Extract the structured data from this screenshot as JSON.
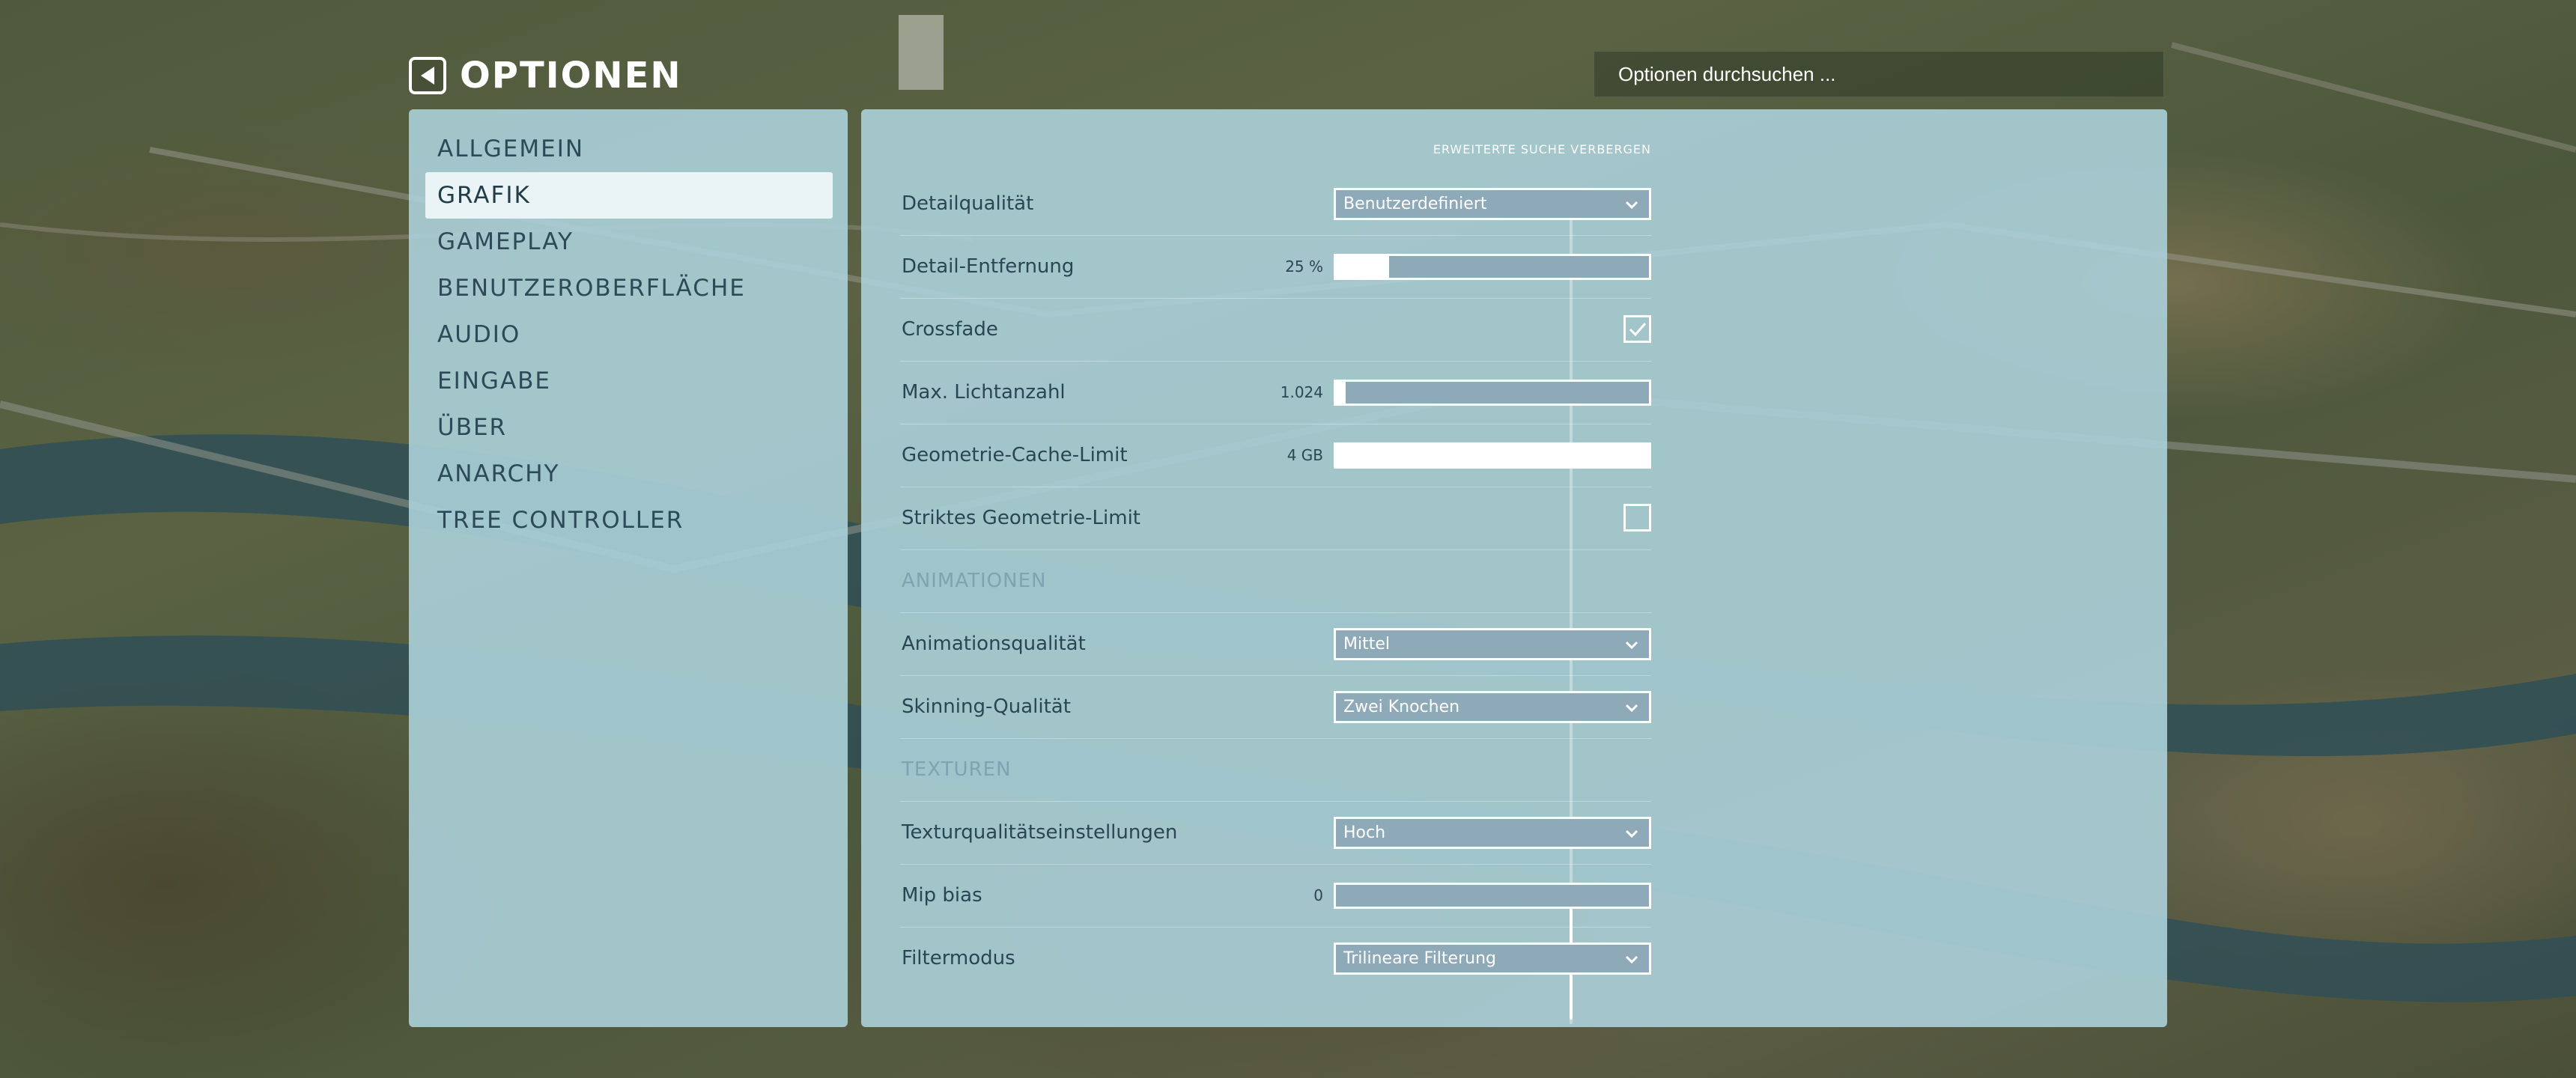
{
  "header": {
    "title": "OPTIONEN",
    "search_placeholder": "Optionen durchsuchen ..."
  },
  "sidebar": {
    "items": [
      {
        "label": "ALLGEMEIN",
        "active": false
      },
      {
        "label": "GRAFIK",
        "active": true
      },
      {
        "label": "GAMEPLAY",
        "active": false
      },
      {
        "label": "BENUTZEROBERFLÄCHE",
        "active": false
      },
      {
        "label": "AUDIO",
        "active": false
      },
      {
        "label": "EINGABE",
        "active": false
      },
      {
        "label": "ÜBER",
        "active": false
      },
      {
        "label": "ANARCHY",
        "active": false
      },
      {
        "label": "TREE CONTROLLER",
        "active": false
      }
    ]
  },
  "main": {
    "advanced_search_toggle": "ERWEITERTE SUCHE VERBERGEN",
    "settings": {
      "detail_quality": {
        "label": "Detailqualität",
        "value": "Benutzerdefiniert"
      },
      "detail_distance": {
        "label": "Detail-Entfernung",
        "value": "25 %",
        "fill_fraction": 0.17
      },
      "crossfade": {
        "label": "Crossfade",
        "checked": true
      },
      "max_lights": {
        "label": "Max. Lichtanzahl",
        "value": "1.024",
        "fill_fraction": 0.03
      },
      "geometry_cache": {
        "label": "Geometrie-Cache-Limit",
        "value": "4 GB",
        "fill_fraction": 1.0
      },
      "strict_geometry": {
        "label": "Striktes Geometrie-Limit",
        "checked": false
      },
      "animations_section": "ANIMATIONEN",
      "animation_quality": {
        "label": "Animationsqualität",
        "value": "Mittel"
      },
      "skinning_quality": {
        "label": "Skinning-Qualität",
        "value": "Zwei Knochen"
      },
      "textures_section": "TEXTUREN",
      "texture_quality": {
        "label": "Texturqualitätseinstellungen",
        "value": "Hoch"
      },
      "mip_bias": {
        "label": "Mip bias",
        "value": "0",
        "fill_fraction": 0.0
      },
      "filter_mode": {
        "label": "Filtermodus",
        "value": "Trilineare Filterung"
      }
    }
  },
  "icons": {
    "back": "back-arrow-icon",
    "dropdown": "chevron-down-icon",
    "check": "checkmark-icon"
  },
  "colors": {
    "panel": "#aad0d8",
    "control_fill": "#8eaab9",
    "text": "#2a4653",
    "section": "#7fa3b0"
  }
}
